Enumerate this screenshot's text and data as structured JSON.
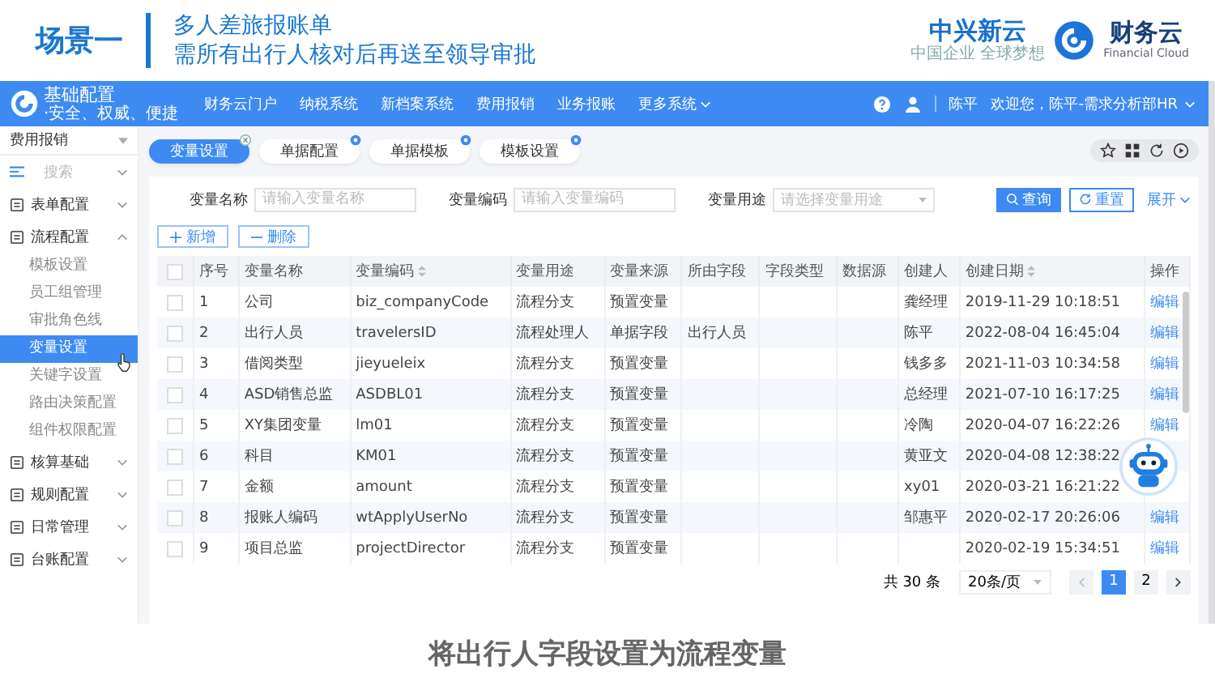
{
  "slide_header": {
    "scene": "场景一",
    "title_lines": [
      "多人差旅报账单",
      "需所有出行人核对后再送至领导审批"
    ],
    "brand": {
      "name": "中兴新云",
      "tagline": "中国企业 全球梦想",
      "product": "财务云",
      "product_en": "Financial Cloud"
    }
  },
  "topbar": {
    "logo": {
      "title": "基础配置",
      "subtitle": "·安全、权威、便捷"
    },
    "nav": [
      {
        "label": "财务云门户",
        "has_menu": false
      },
      {
        "label": "纳税系统",
        "has_menu": false
      },
      {
        "label": "新档案系统",
        "has_menu": false
      },
      {
        "label": "费用报销",
        "has_menu": false
      },
      {
        "label": "业务报账",
        "has_menu": false
      },
      {
        "label": "更多系统",
        "has_menu": true
      }
    ],
    "user_name": "陈平",
    "greeting": "欢迎您，陈平-需求分析部HR"
  },
  "sidebar": {
    "module": "费用报销",
    "search_placeholder": "搜索",
    "items": [
      {
        "label": "表单配置",
        "expanded": false
      },
      {
        "label": "流程配置",
        "expanded": true,
        "children": [
          {
            "label": "模板设置",
            "selected": false
          },
          {
            "label": "员工组管理",
            "selected": false
          },
          {
            "label": "审批角色线",
            "selected": false
          },
          {
            "label": "变量设置",
            "selected": true
          },
          {
            "label": "关键字设置",
            "selected": false
          },
          {
            "label": "路由决策配置",
            "selected": false
          },
          {
            "label": "组件权限配置",
            "selected": false
          }
        ]
      },
      {
        "label": "核算基础",
        "expanded": false
      },
      {
        "label": "规则配置",
        "expanded": false
      },
      {
        "label": "日常管理",
        "expanded": false
      },
      {
        "label": "台账配置",
        "expanded": false
      }
    ]
  },
  "tabs": [
    {
      "label": "变量设置",
      "selected": true
    },
    {
      "label": "单据配置",
      "selected": false
    },
    {
      "label": "单据模板",
      "selected": false
    },
    {
      "label": "模板设置",
      "selected": false
    }
  ],
  "filters": [
    {
      "label": "变量名称",
      "placeholder": "请输入变量名称",
      "kind": "text"
    },
    {
      "label": "变量编码",
      "placeholder": "请输入变量编码",
      "kind": "text"
    },
    {
      "label": "变量用途",
      "placeholder": "请选择变量用途",
      "kind": "select"
    }
  ],
  "filter_buttons": {
    "query": "查询",
    "reset": "重置",
    "expand": "展开"
  },
  "table_actions": [
    {
      "label": "新增",
      "kind": "add"
    },
    {
      "label": "删除",
      "kind": "delete"
    }
  ],
  "table": {
    "select_all_checked": false,
    "columns": [
      {
        "label": "序号",
        "sortable": false
      },
      {
        "label": "变量名称",
        "sortable": false
      },
      {
        "label": "变量编码",
        "sortable": true
      },
      {
        "label": "变量用途",
        "sortable": false
      },
      {
        "label": "变量来源",
        "sortable": false
      },
      {
        "label": "所由字段",
        "sortable": false
      },
      {
        "label": "字段类型",
        "sortable": false
      },
      {
        "label": "数据源",
        "sortable": false
      },
      {
        "label": "创建人",
        "sortable": false
      },
      {
        "label": "创建日期",
        "sortable": true
      },
      {
        "label": "操作",
        "sortable": false
      }
    ],
    "rows": [
      {
        "cells": [
          "1",
          "公司",
          "biz_companyCode",
          "流程分支",
          "预置变量",
          "",
          "",
          "",
          "龚经理",
          "2019-11-29 10:18:51"
        ],
        "checked": false,
        "action": "编辑"
      },
      {
        "cells": [
          "2",
          "出行人员",
          "travelersID",
          "流程处理人",
          "单据字段",
          "出行人员",
          "",
          "",
          "陈平",
          "2022-08-04 16:45:04"
        ],
        "checked": false,
        "action": "编辑"
      },
      {
        "cells": [
          "3",
          "借阅类型",
          "jieyueleix",
          "流程分支",
          "预置变量",
          "",
          "",
          "",
          "钱多多",
          "2021-11-03 10:34:58"
        ],
        "checked": false,
        "action": "编辑"
      },
      {
        "cells": [
          "4",
          "ASD销售总监",
          "ASDBL01",
          "流程分支",
          "预置变量",
          "",
          "",
          "",
          "总经理",
          "2021-07-10 16:17:25"
        ],
        "checked": false,
        "action": "编辑"
      },
      {
        "cells": [
          "5",
          "XY集团变量",
          "lm01",
          "流程分支",
          "预置变量",
          "",
          "",
          "",
          "冷陶",
          "2020-04-07 16:22:26"
        ],
        "checked": false,
        "action": "编辑"
      },
      {
        "cells": [
          "6",
          "科目",
          "KM01",
          "流程分支",
          "预置变量",
          "",
          "",
          "",
          "黄亚文",
          "2020-04-08 12:38:22"
        ],
        "checked": false
      },
      {
        "cells": [
          "7",
          "金额",
          "amount",
          "流程分支",
          "预置变量",
          "",
          "",
          "",
          "xy01",
          "2020-03-21 16:21:22"
        ],
        "checked": false
      },
      {
        "cells": [
          "8",
          "报账人编码",
          "wtApplyUserNo",
          "流程分支",
          "预置变量",
          "",
          "",
          "",
          "邹惠平",
          "2020-02-17 20:26:06"
        ],
        "checked": false,
        "action": "编辑"
      },
      {
        "cells": [
          "9",
          "项目总监",
          "projectDirector",
          "流程分支",
          "预置变量",
          "",
          "",
          "",
          "",
          "2020-02-19 15:34:51"
        ],
        "checked": false,
        "action": "编辑"
      }
    ]
  },
  "pagination": {
    "total": "共 30 条",
    "page_size": "20条/页",
    "pages": [
      {
        "label": "1",
        "selected": true
      },
      {
        "label": "2",
        "selected": false
      }
    ]
  },
  "caption": "将出行人字段设置为流程变量"
}
